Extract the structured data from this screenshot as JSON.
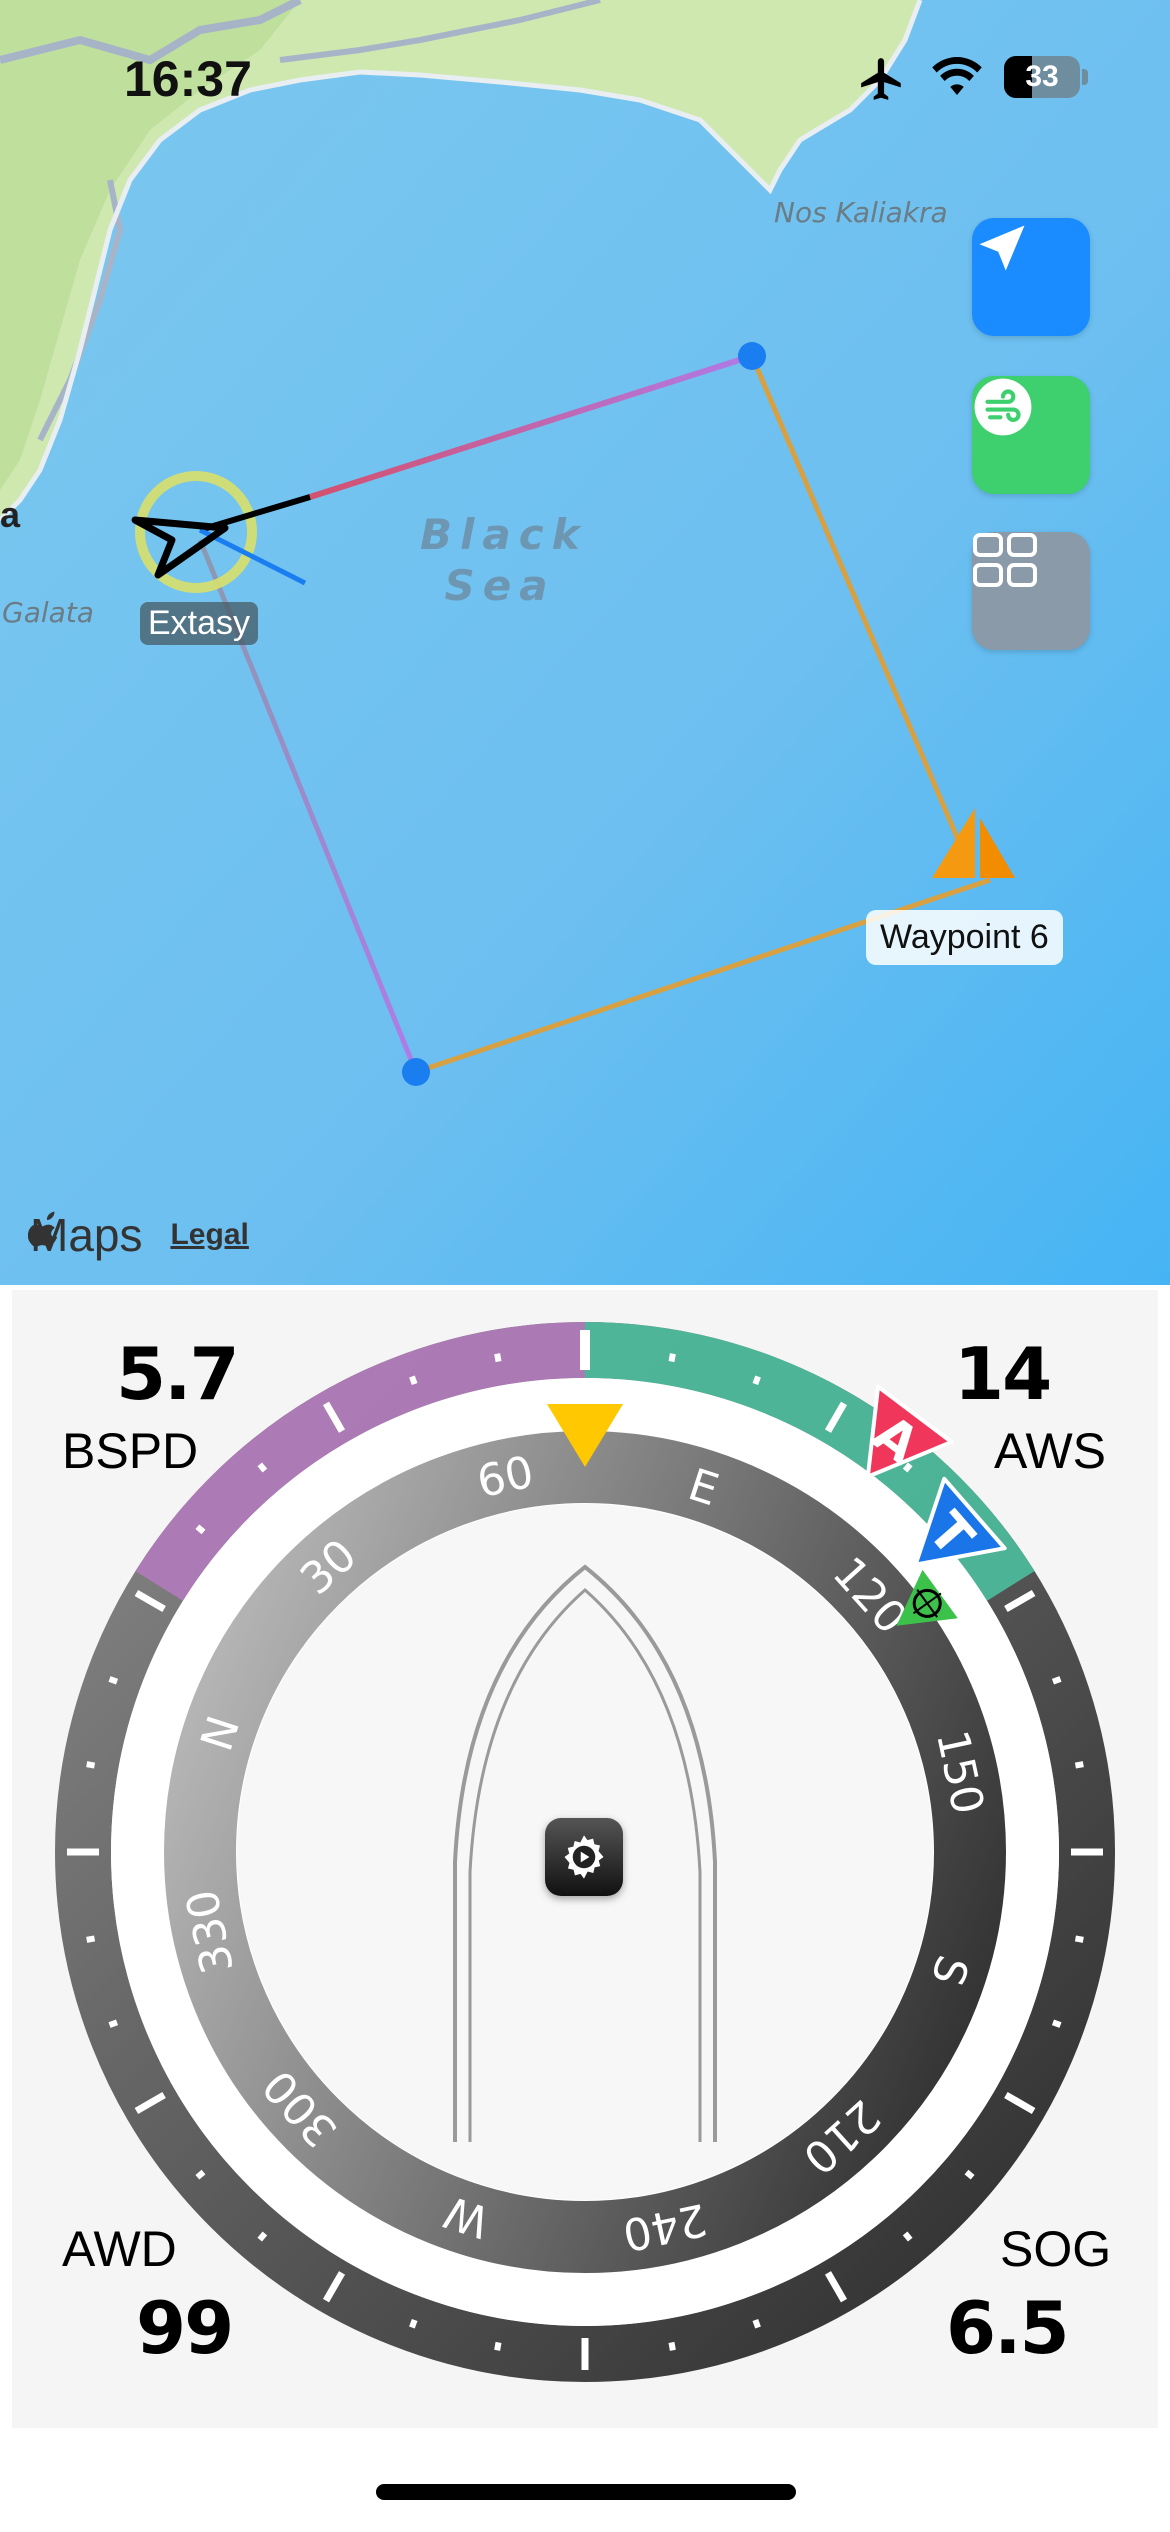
{
  "status_bar": {
    "time": "16:37",
    "battery": "33"
  },
  "map": {
    "sea_name_line1": "Black",
    "sea_name_line2": "Sea",
    "place_nos_kaliakra": "Nos Kaliakra",
    "place_galata": "Galata",
    "edge_letter": "a",
    "boat_name": "Extasy",
    "waypoint_label": "Waypoint 6",
    "attribution_brand": "Maps",
    "attribution_legal": "Legal",
    "buttons": [
      {
        "icon": "location-arrow-icon",
        "color": "#1a8cff"
      },
      {
        "icon": "wind-icon",
        "color": "#3ecf6e"
      },
      {
        "icon": "grid-icon",
        "color": "#8a9aa8"
      }
    ],
    "colors": {
      "water": "#6fc0ee",
      "land": "#cfe8b0",
      "route_orange": "#e8a23a",
      "route_purple": "#b07ae8"
    }
  },
  "instrument": {
    "top_left": {
      "value": "5.7",
      "label": "BSPD"
    },
    "top_right": {
      "value": "14",
      "label": "AWS"
    },
    "bottom_left": {
      "value": "99",
      "label": "AWD"
    },
    "bottom_right": {
      "value": "6.5",
      "label": "SOG"
    },
    "apparent_marker": "A",
    "true_marker": "T",
    "compass_labels": [
      "60",
      "E",
      "120",
      "150",
      "S",
      "210",
      "240",
      "W",
      "300",
      "330",
      "N",
      "30"
    ],
    "colors": {
      "port_arc": "#b07ab8",
      "stbd_arc": "#4db89a",
      "apparent": "#f0365a",
      "true": "#1a75e8",
      "heading_marker": "#ffc800",
      "target": "#3cc24a"
    }
  }
}
